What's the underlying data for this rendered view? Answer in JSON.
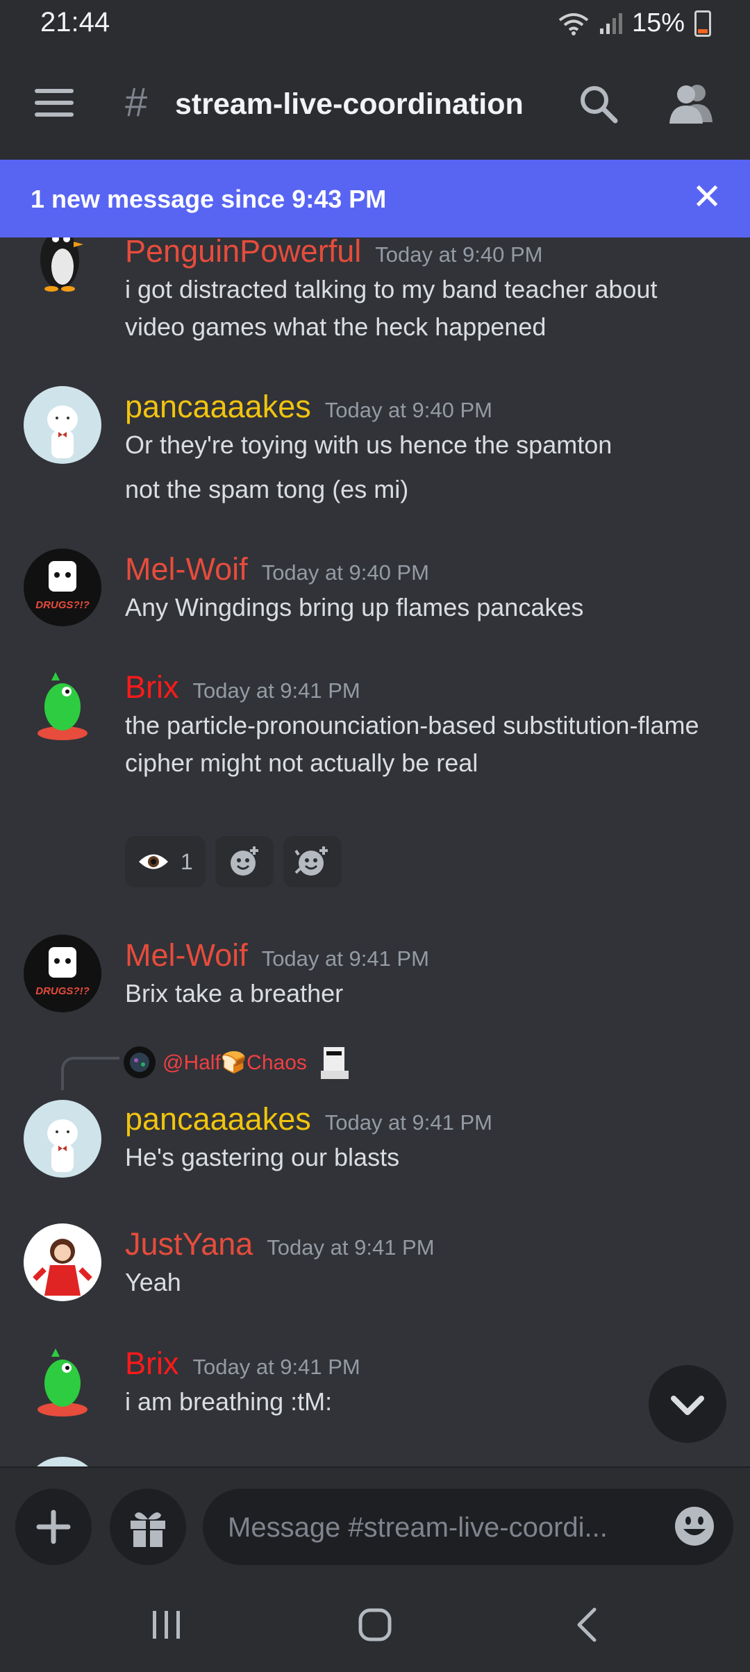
{
  "status_bar": {
    "time": "21:44",
    "battery": "15%"
  },
  "header": {
    "channel": "stream-live-coordination",
    "hash": "#"
  },
  "banner": {
    "text": "1 new message since 9:43 PM",
    "close": "✕"
  },
  "messages": [
    {
      "username": "PenguinPowerful",
      "color": "#e74c3c",
      "time": "Today at 9:40 PM",
      "text": "i got distracted talking to my band teacher about video games what the heck happened"
    },
    {
      "username": "pancaaaakes",
      "color": "#f1c40f",
      "time": "Today at 9:40 PM",
      "text": "Or they're toying with us hence the spamton",
      "text2": "not the spam tong (es mi)"
    },
    {
      "username": "Mel-Woif",
      "color": "#e74c3c",
      "time": "Today at 9:40 PM",
      "text": "Any Wingdings bring up flames pancakes"
    },
    {
      "username": "Brix",
      "color": "#ff1a1a",
      "time": "Today at 9:41 PM",
      "text": "the particle-pronounciation-based substitution-flame cipher might not actually be real",
      "reaction_count": "1"
    },
    {
      "username": "Mel-Woif",
      "color": "#e74c3c",
      "time": "Today at 9:41 PM",
      "text": "Brix take a breather"
    },
    {
      "username": "pancaaaakes",
      "color": "#f1c40f",
      "time": "Today at 9:41 PM",
      "text": "He's gastering our blasts",
      "reply_to": "@Half🍞Chaos"
    },
    {
      "username": "JustYana",
      "color": "#e74c3c",
      "time": "Today at 9:41 PM",
      "text": "Yeah"
    },
    {
      "username": "Brix",
      "color": "#ff1a1a",
      "time": "Today at 9:41 PM",
      "text": "i am breathing :tM:"
    }
  ],
  "composer": {
    "placeholder": "Message #stream-live-coordi..."
  }
}
